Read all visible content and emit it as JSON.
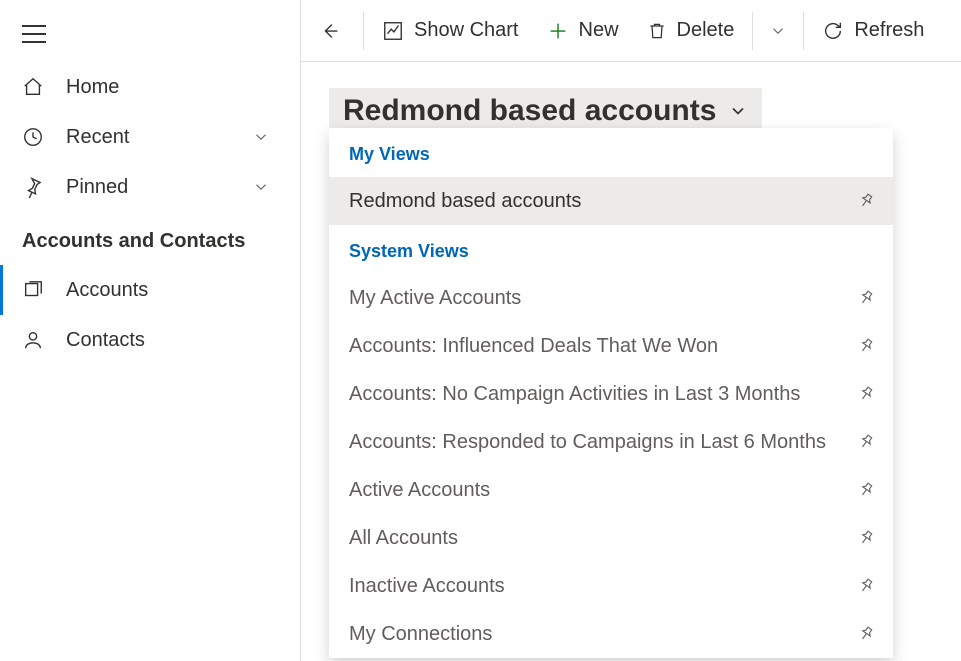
{
  "sidebar": {
    "items": [
      {
        "label": "Home"
      },
      {
        "label": "Recent"
      },
      {
        "label": "Pinned"
      }
    ],
    "group_label": "Accounts and Contacts",
    "sublinks": [
      {
        "label": "Accounts"
      },
      {
        "label": "Contacts"
      }
    ]
  },
  "toolbar": {
    "show_chart": "Show Chart",
    "new": "New",
    "delete": "Delete",
    "refresh": "Refresh"
  },
  "view": {
    "title": "Redmond based accounts"
  },
  "dropdown": {
    "my_views_label": "My Views",
    "system_views_label": "System Views",
    "my_views": [
      {
        "label": "Redmond based accounts"
      }
    ],
    "system_views": [
      {
        "label": "My Active Accounts"
      },
      {
        "label": "Accounts: Influenced Deals That We Won"
      },
      {
        "label": "Accounts: No Campaign Activities in Last 3 Months"
      },
      {
        "label": "Accounts: Responded to Campaigns in Last 6 Months"
      },
      {
        "label": "Active Accounts"
      },
      {
        "label": "All Accounts"
      },
      {
        "label": "Inactive Accounts"
      },
      {
        "label": "My Connections"
      }
    ]
  }
}
